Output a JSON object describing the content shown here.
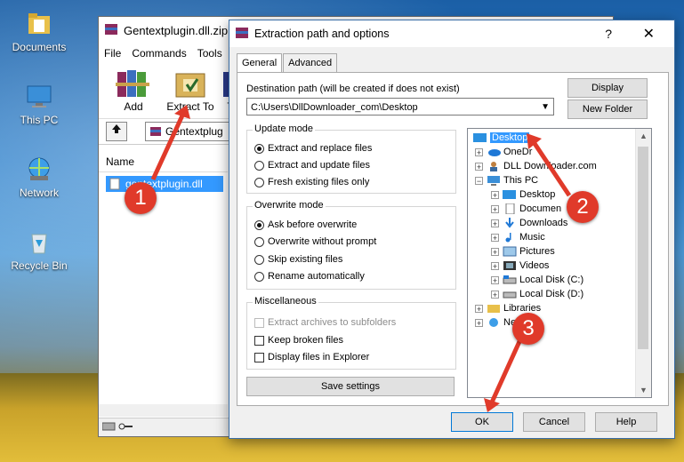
{
  "desktop": {
    "icons": [
      {
        "label": "Documents"
      },
      {
        "label": "This PC"
      },
      {
        "label": "Network"
      },
      {
        "label": "Recycle Bin"
      }
    ]
  },
  "winrar": {
    "title": "Gentextplugin.dll.zip",
    "menu": [
      "File",
      "Commands",
      "Tools"
    ],
    "tools": [
      {
        "label": "Add"
      },
      {
        "label": "Extract To"
      },
      {
        "label": "T"
      }
    ],
    "address": "Gentextplug",
    "list_header": "Name",
    "file": "gentextplugin.dll"
  },
  "dialog": {
    "title": "Extraction path and options",
    "help": "?",
    "close": "✕",
    "tabs": [
      "General",
      "Advanced"
    ],
    "dest_label": "Destination path (will be created if does not exist)",
    "dest_value": "C:\\Users\\DllDownloader_com\\Desktop",
    "display_btn": "Display",
    "new_folder_btn": "New Folder",
    "update_mode": {
      "title": "Update mode",
      "options": [
        "Extract and replace files",
        "Extract and update files",
        "Fresh existing files only"
      ]
    },
    "overwrite_mode": {
      "title": "Overwrite mode",
      "options": [
        "Ask before overwrite",
        "Overwrite without prompt",
        "Skip existing files",
        "Rename automatically"
      ]
    },
    "misc": {
      "title": "Miscellaneous",
      "options": [
        "Extract archives to subfolders",
        "Keep broken files",
        "Display files in Explorer"
      ]
    },
    "save_settings": "Save settings",
    "tree": [
      {
        "label": "Desktop"
      },
      {
        "label": "OneDr"
      },
      {
        "label": "DLL Downloader.com"
      },
      {
        "label": "This PC"
      },
      {
        "label": "Desktop"
      },
      {
        "label": "Documen"
      },
      {
        "label": "Downloads"
      },
      {
        "label": "Music"
      },
      {
        "label": "Pictures"
      },
      {
        "label": "Videos"
      },
      {
        "label": "Local Disk (C:)"
      },
      {
        "label": "Local Disk (D:)"
      },
      {
        "label": "Libraries"
      },
      {
        "label": "Ne"
      }
    ],
    "ok": "OK",
    "cancel": "Cancel",
    "help_btn": "Help"
  },
  "annotations": [
    "1",
    "2",
    "3"
  ],
  "colors": {
    "annotation": "#e03a2a",
    "selection": "#3399ff"
  }
}
